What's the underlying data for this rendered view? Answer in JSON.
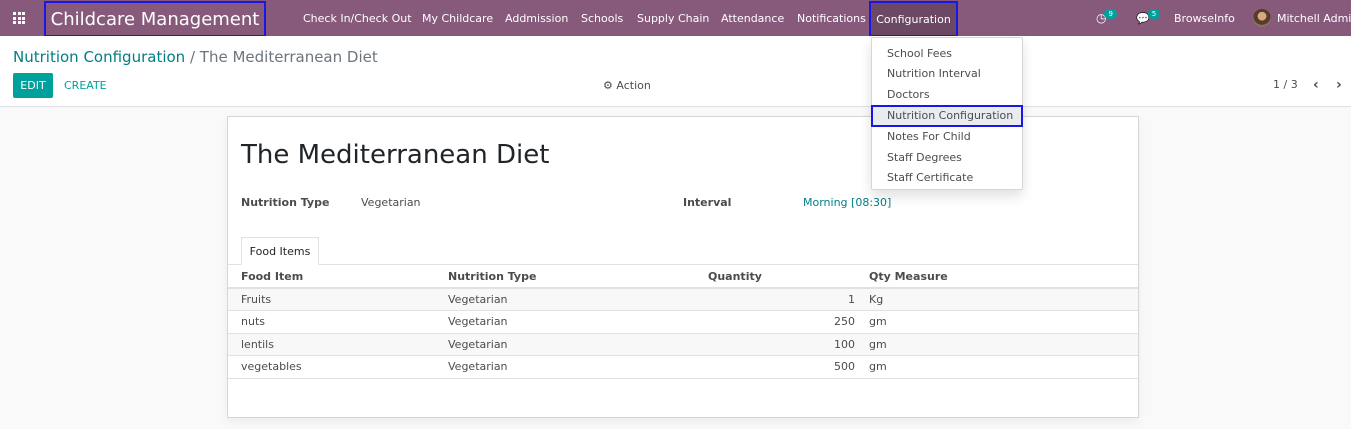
{
  "navbar": {
    "brand": "Childcare Management",
    "menu": [
      {
        "label": "Check In/Check Out"
      },
      {
        "label": "My Childcare"
      },
      {
        "label": "Addmission"
      },
      {
        "label": "Schools"
      },
      {
        "label": "Supply Chain"
      },
      {
        "label": "Attendance"
      },
      {
        "label": "Notifications"
      }
    ],
    "config_label": "Configuration",
    "activity_count": "9",
    "message_count": "5",
    "company": "BrowseInfo",
    "user": "Mitchell Admin"
  },
  "control_panel": {
    "breadcrumb_parent": "Nutrition Configuration",
    "breadcrumb_sep": "/",
    "breadcrumb_current": "The Mediterranean Diet",
    "edit_label": "EDIT",
    "create_label": "CREATE",
    "action_label": "Action",
    "pager": "1 / 3"
  },
  "record": {
    "title": "The Mediterranean Diet",
    "nutrition_type_label": "Nutrition Type",
    "nutrition_type_value": "Vegetarian",
    "interval_label": "Interval",
    "interval_value": "Morning [08:30]"
  },
  "tab": {
    "label": "Food Items"
  },
  "food_table": {
    "headers": {
      "food_item": "Food Item",
      "nutrition_type": "Nutrition Type",
      "quantity": "Quantity",
      "qty_measure": "Qty Measure"
    },
    "rows": [
      {
        "food_item": "Fruits",
        "nutrition_type": "Vegetarian",
        "quantity": "1",
        "qty_measure": "Kg"
      },
      {
        "food_item": "nuts",
        "nutrition_type": "Vegetarian",
        "quantity": "250",
        "qty_measure": "gm"
      },
      {
        "food_item": "lentils",
        "nutrition_type": "Vegetarian",
        "quantity": "100",
        "qty_measure": "gm"
      },
      {
        "food_item": "vegetables",
        "nutrition_type": "Vegetarian",
        "quantity": "500",
        "qty_measure": "gm"
      }
    ]
  },
  "config_dropdown": {
    "items": [
      {
        "label": "School Fees"
      },
      {
        "label": "Nutrition Interval"
      },
      {
        "label": "Doctors"
      },
      {
        "label": "Nutrition Configuration"
      },
      {
        "label": "Notes For Child"
      },
      {
        "label": "Staff Degrees"
      },
      {
        "label": "Staff Certificate"
      }
    ]
  },
  "colors": {
    "navbar": "#875a7b",
    "accent": "#00a09d",
    "link": "#017e84",
    "highlight_border": "#1a16e8"
  }
}
